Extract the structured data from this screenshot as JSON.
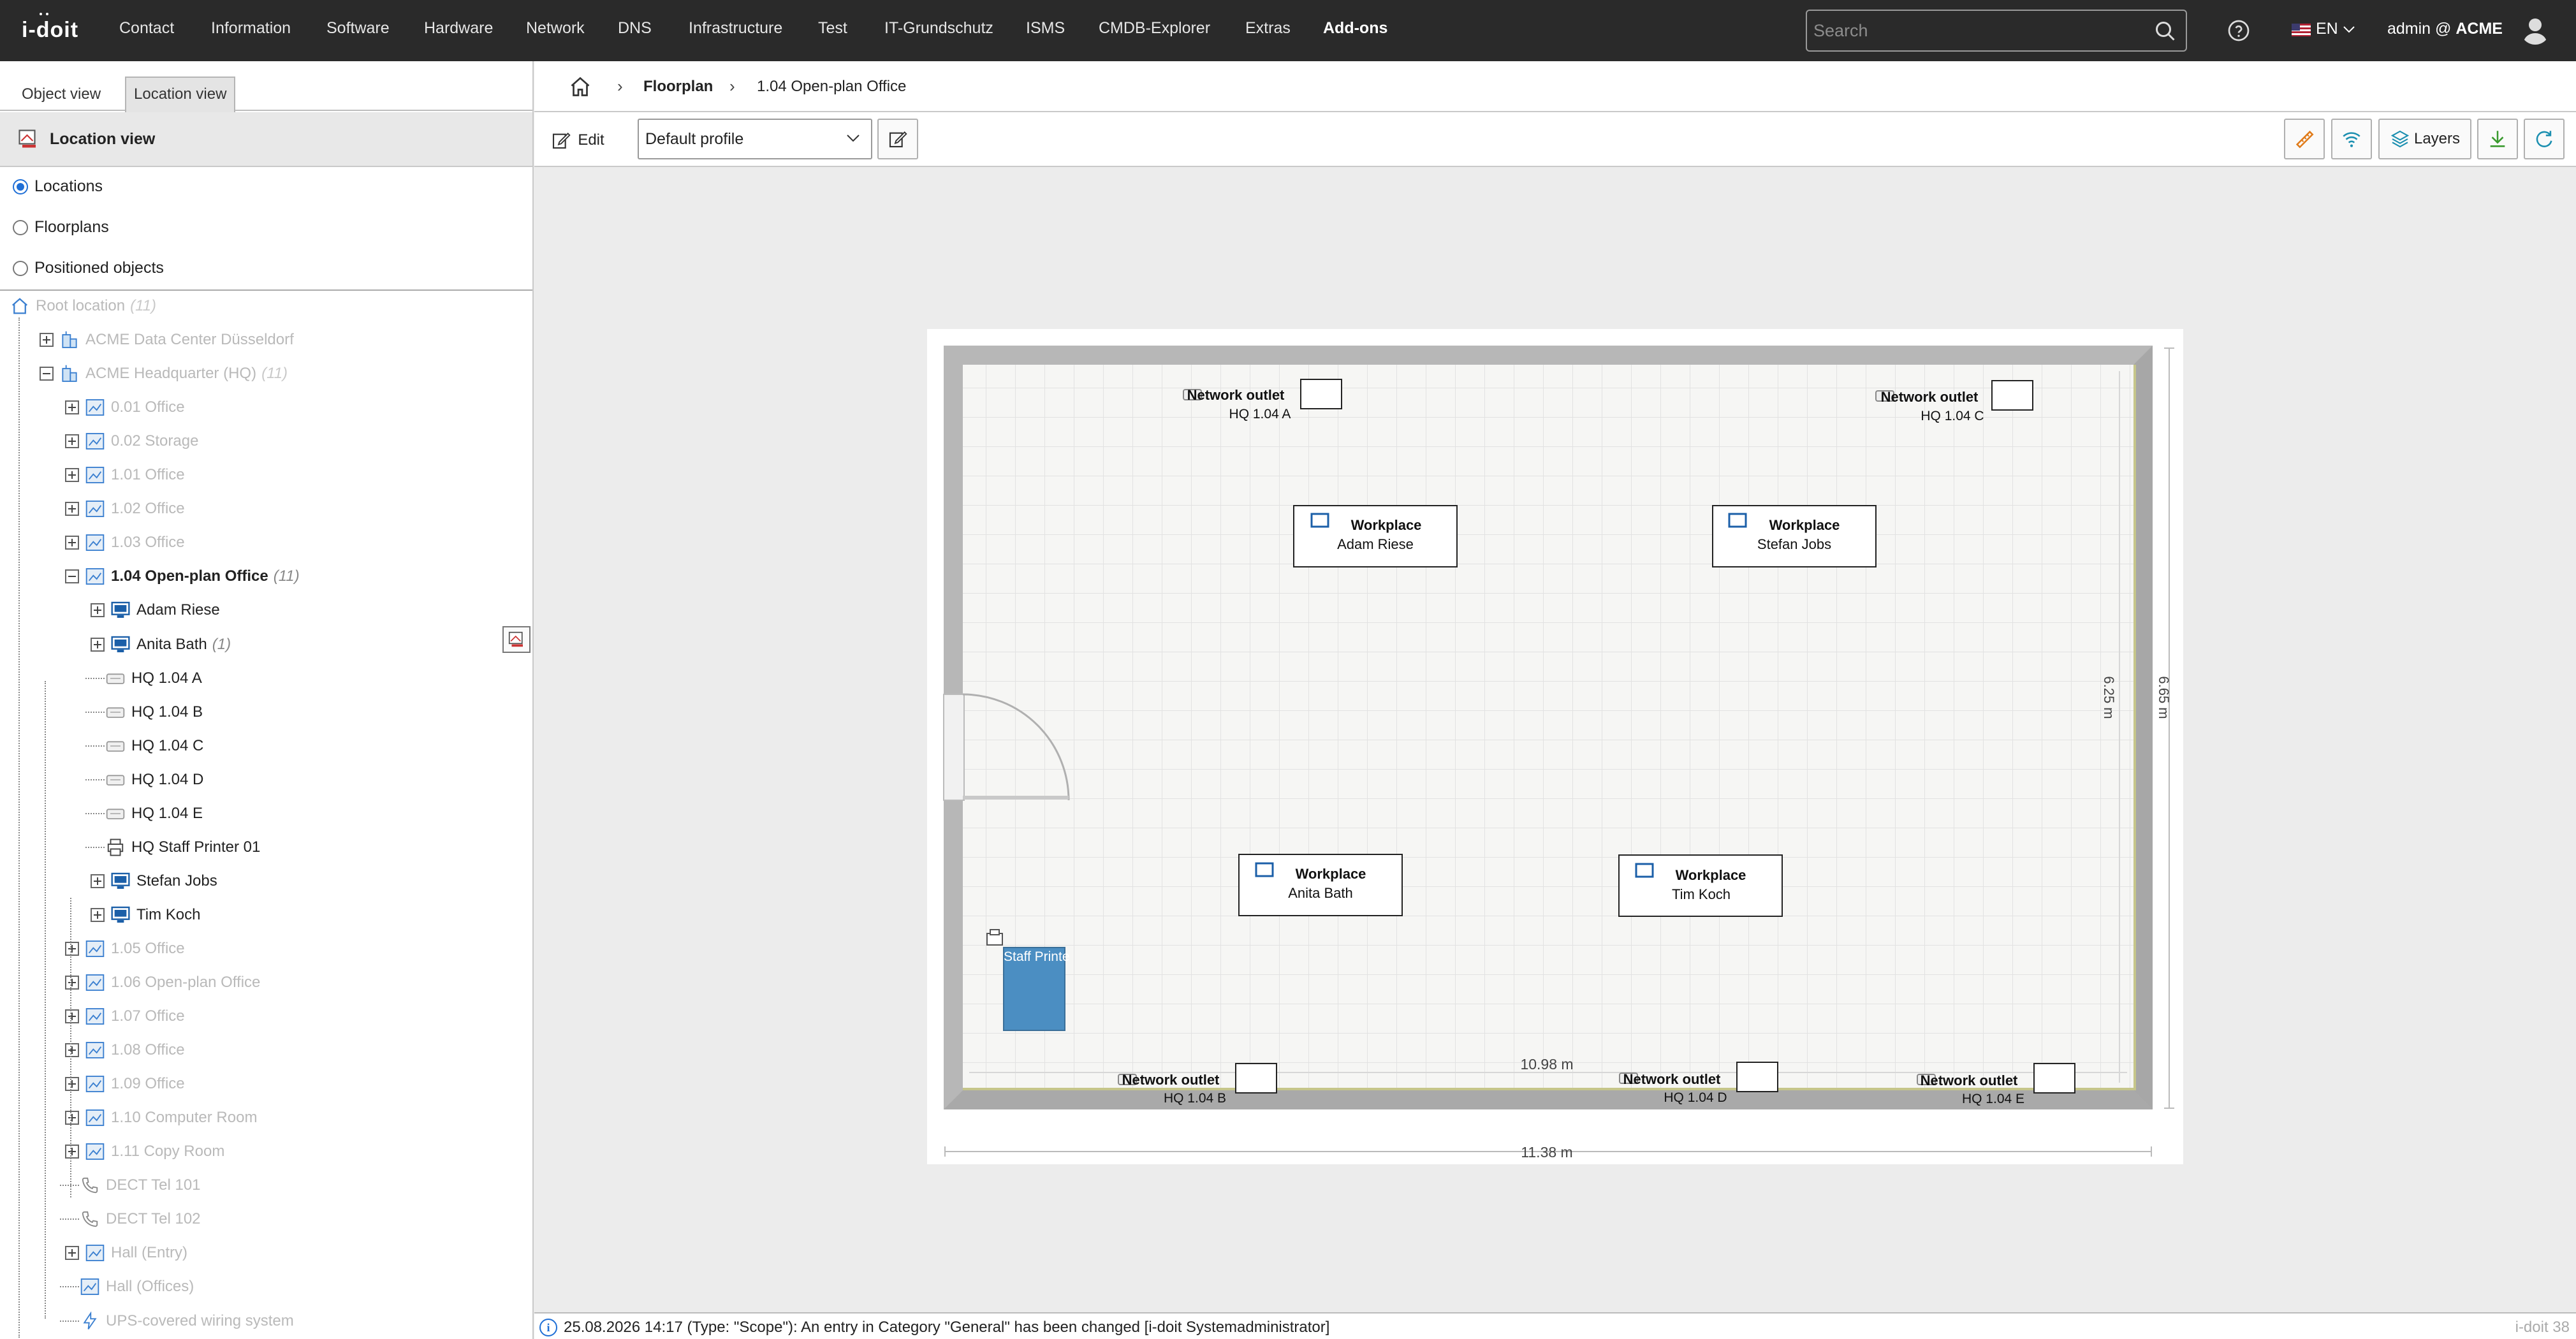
{
  "topbar": {
    "logo": "i-doit",
    "nav": [
      {
        "label": "Contact",
        "active": false
      },
      {
        "label": "Information",
        "active": false
      },
      {
        "label": "Software",
        "active": false
      },
      {
        "label": "Hardware",
        "active": false
      },
      {
        "label": "Network",
        "active": false
      },
      {
        "label": "DNS",
        "active": false
      },
      {
        "label": "Infrastructure",
        "active": false
      },
      {
        "label": "Test",
        "active": false
      },
      {
        "label": "IT-Grundschutz",
        "active": false
      },
      {
        "label": "ISMS",
        "active": false
      },
      {
        "label": "CMDB-Explorer",
        "active": false
      },
      {
        "label": "Extras",
        "active": false
      },
      {
        "label": "Add-ons",
        "active": true
      }
    ],
    "search_placeholder": "Search",
    "language": "EN",
    "user_prefix": "admin @",
    "tenant": "ACME"
  },
  "left": {
    "tabs": [
      "Object view",
      "Location view"
    ],
    "active_tab": "Location view",
    "header": "Location view",
    "radios": [
      {
        "label": "Locations",
        "checked": true
      },
      {
        "label": "Floorplans",
        "checked": false
      },
      {
        "label": "Positioned objects",
        "checked": false
      }
    ],
    "tree": [
      {
        "label": "Root location",
        "count": "(11)",
        "level": 0,
        "expander": "none",
        "icon": "home-icon",
        "dim": true
      },
      {
        "label": "ACME Data Center Düsseldorf",
        "count": "",
        "level": 1,
        "expander": "plus",
        "icon": "building-icon",
        "dim": true
      },
      {
        "label": "ACME Headquarter (HQ)",
        "count": "(11)",
        "level": 1,
        "expander": "minus",
        "icon": "building-icon",
        "dim": true
      },
      {
        "label": "0.01 Office",
        "count": "",
        "level": 2,
        "expander": "plus",
        "icon": "room-icon",
        "dim": true
      },
      {
        "label": "0.02 Storage",
        "count": "",
        "level": 2,
        "expander": "plus",
        "icon": "room-icon",
        "dim": true
      },
      {
        "label": "1.01 Office",
        "count": "",
        "level": 2,
        "expander": "plus",
        "icon": "room-icon",
        "dim": true
      },
      {
        "label": "1.02 Office",
        "count": "",
        "level": 2,
        "expander": "plus",
        "icon": "room-icon",
        "dim": true
      },
      {
        "label": "1.03 Office",
        "count": "",
        "level": 2,
        "expander": "plus",
        "icon": "room-icon",
        "dim": true
      },
      {
        "label": "1.04 Open-plan Office",
        "count": "(11)",
        "level": 2,
        "expander": "minus",
        "icon": "room-icon",
        "dim": false,
        "bold": true
      },
      {
        "label": "Adam Riese",
        "count": "",
        "level": 3,
        "expander": "plus",
        "icon": "workstation-icon",
        "dim": false
      },
      {
        "label": "Anita Bath",
        "count": "(1)",
        "level": 3,
        "expander": "plus",
        "icon": "workstation-icon",
        "dim": false
      },
      {
        "label": "HQ 1.04 A",
        "count": "",
        "level": 3,
        "expander": "none",
        "icon": "outlet-icon",
        "dim": false
      },
      {
        "label": "HQ 1.04 B",
        "count": "",
        "level": 3,
        "expander": "none",
        "icon": "outlet-icon",
        "dim": false
      },
      {
        "label": "HQ 1.04 C",
        "count": "",
        "level": 3,
        "expander": "none",
        "icon": "outlet-icon",
        "dim": false
      },
      {
        "label": "HQ 1.04 D",
        "count": "",
        "level": 3,
        "expander": "none",
        "icon": "outlet-icon",
        "dim": false
      },
      {
        "label": "HQ 1.04 E",
        "count": "",
        "level": 3,
        "expander": "none",
        "icon": "outlet-icon",
        "dim": false
      },
      {
        "label": "HQ Staff Printer 01",
        "count": "",
        "level": 3,
        "expander": "none",
        "icon": "printer-icon",
        "dim": false
      },
      {
        "label": "Stefan Jobs",
        "count": "",
        "level": 3,
        "expander": "plus",
        "icon": "workstation-icon",
        "dim": false
      },
      {
        "label": "Tim Koch",
        "count": "",
        "level": 3,
        "expander": "plus",
        "icon": "workstation-icon",
        "dim": false
      },
      {
        "label": "1.05 Office",
        "count": "",
        "level": 2,
        "expander": "plus",
        "icon": "room-icon",
        "dim": true
      },
      {
        "label": "1.06 Open-plan Office",
        "count": "",
        "level": 2,
        "expander": "plus",
        "icon": "room-icon",
        "dim": true
      },
      {
        "label": "1.07 Office",
        "count": "",
        "level": 2,
        "expander": "plus",
        "icon": "room-icon",
        "dim": true
      },
      {
        "label": "1.08 Office",
        "count": "",
        "level": 2,
        "expander": "plus",
        "icon": "room-icon",
        "dim": true
      },
      {
        "label": "1.09 Office",
        "count": "",
        "level": 2,
        "expander": "plus",
        "icon": "room-icon",
        "dim": true
      },
      {
        "label": "1.10 Computer Room",
        "count": "",
        "level": 2,
        "expander": "plus",
        "icon": "room-icon",
        "dim": true
      },
      {
        "label": "1.11 Copy Room",
        "count": "",
        "level": 2,
        "expander": "plus",
        "icon": "room-icon",
        "dim": true
      },
      {
        "label": "DECT Tel 101",
        "count": "",
        "level": 2,
        "expander": "none",
        "icon": "phone-icon",
        "dim": true
      },
      {
        "label": "DECT Tel 102",
        "count": "",
        "level": 2,
        "expander": "none",
        "icon": "phone-icon",
        "dim": true
      },
      {
        "label": "Hall (Entry)",
        "count": "",
        "level": 2,
        "expander": "plus",
        "icon": "room-icon",
        "dim": true
      },
      {
        "label": "Hall (Offices)",
        "count": "",
        "level": 2,
        "expander": "none",
        "icon": "room-icon",
        "dim": true
      },
      {
        "label": "UPS-covered wiring system",
        "count": "",
        "level": 2,
        "expander": "none",
        "icon": "power-icon",
        "dim": true
      }
    ]
  },
  "breadcrumb": {
    "items": [
      "Floorplan",
      "1.04 Open-plan Office"
    ]
  },
  "toolbar": {
    "edit_label": "Edit",
    "profile": "Default profile",
    "layers_label": "Layers"
  },
  "floorplan": {
    "dim_height_inner": "6.25 m",
    "dim_height_outer": "6.65 m",
    "dim_width_inner": "10.98 m",
    "dim_width_outer": "11.38 m",
    "outlets": [
      {
        "type": "Network outlet",
        "name": "HQ 1.04 A"
      },
      {
        "type": "Network outlet",
        "name": "HQ 1.04 C"
      },
      {
        "type": "Network outlet",
        "name": "HQ 1.04 B"
      },
      {
        "type": "Network outlet",
        "name": "HQ 1.04 D"
      },
      {
        "type": "Network outlet",
        "name": "HQ 1.04 E"
      }
    ],
    "workplaces": [
      {
        "type": "Workplace",
        "name": "Adam Riese"
      },
      {
        "type": "Workplace",
        "name": "Stefan Jobs"
      },
      {
        "type": "Workplace",
        "name": "Anita Bath"
      },
      {
        "type": "Workplace",
        "name": "Tim Koch"
      }
    ],
    "printer_label": "Staff Printe"
  },
  "status": {
    "message": "25.08.2026 14:17 (Type: \"Scope\"): An entry in Category \"General\" has been changed [i-doit Systemadministrator]",
    "version": "i-doit 38"
  },
  "colors": {
    "topbar": "#2a2a2a",
    "accent": "#1f6fd6",
    "orange_button": "#e07b1a",
    "teal_button": "#1b8fb0",
    "green_button": "#3a9a2e",
    "printer_fill": "#4b8ec2"
  }
}
